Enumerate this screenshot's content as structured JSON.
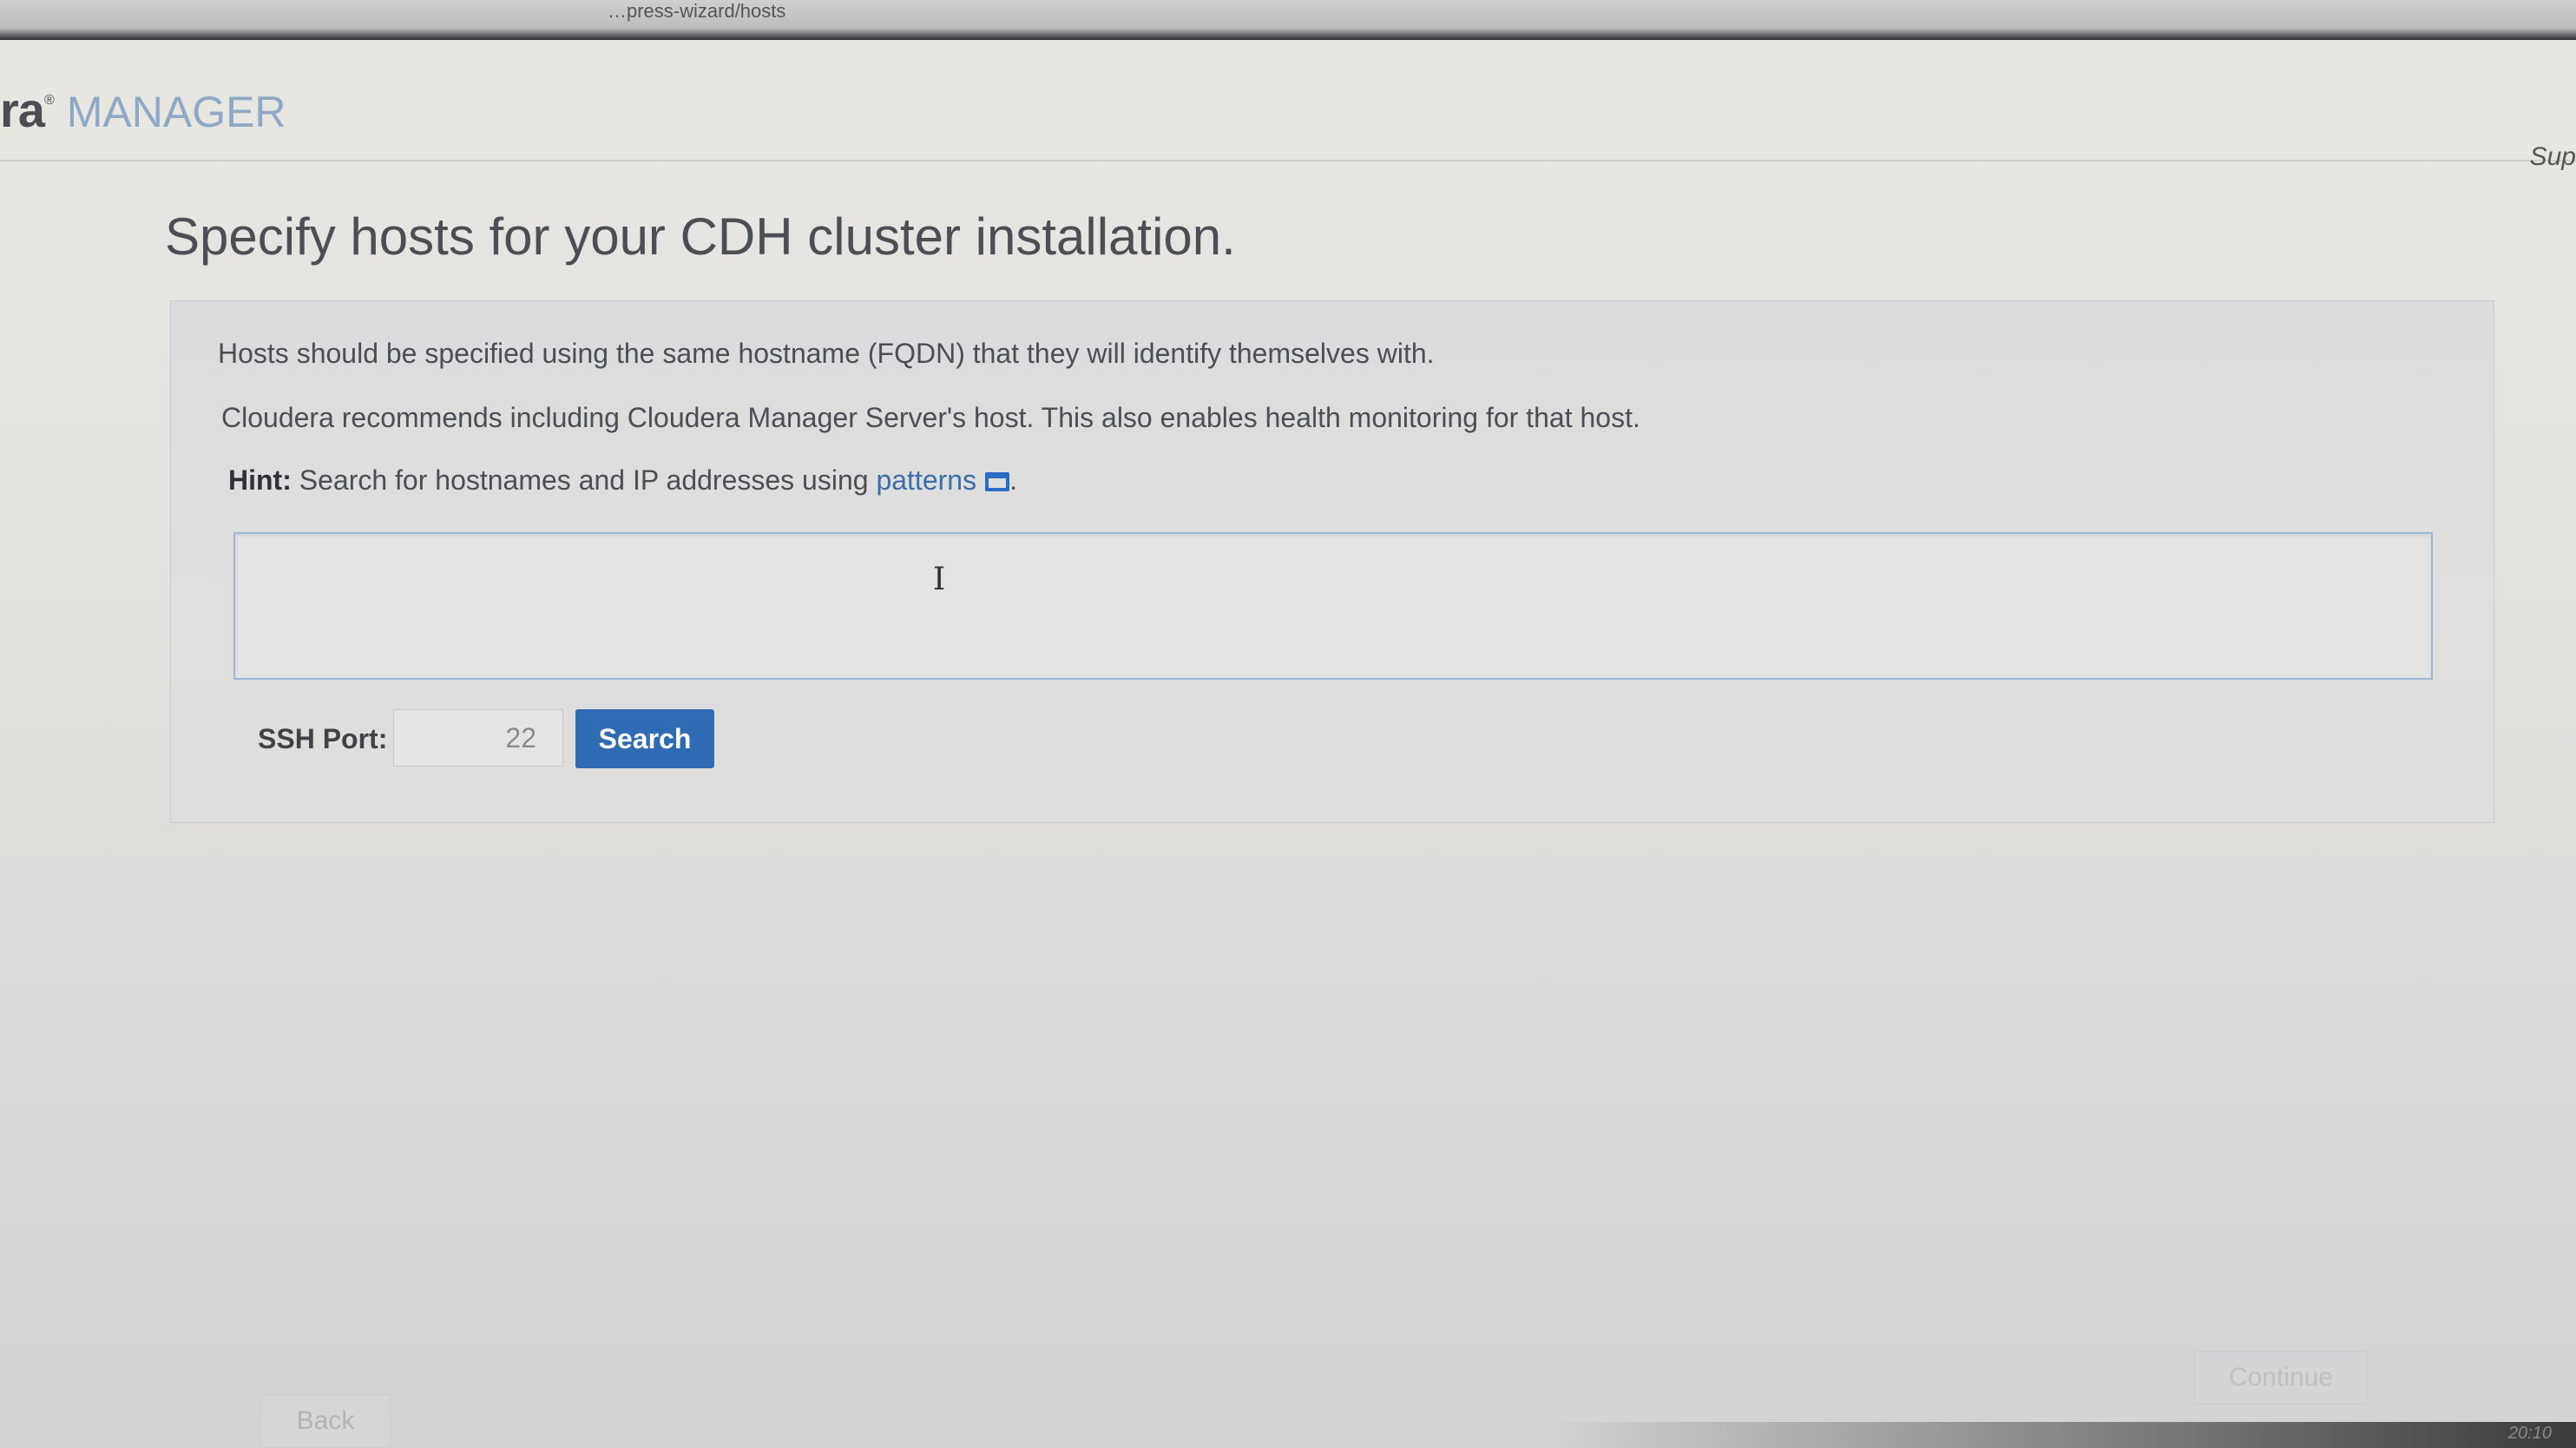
{
  "browser": {
    "url_fragment": "…press-wizard/hosts"
  },
  "header": {
    "brand_prefix": "ra",
    "brand_reg": "®",
    "brand_name": "MANAGER",
    "support_label": "Sup"
  },
  "page": {
    "title": "Specify hosts for your CDH cluster installation."
  },
  "panel": {
    "info_1": "Hosts should be specified using the same hostname (FQDN) that they will identify themselves with.",
    "info_2": "Cloudera recommends including Cloudera Manager Server's host. This also enables health monitoring for that host.",
    "hint_label": "Hint:",
    "hint_text": " Search for hostnames and IP addresses using ",
    "hint_link": "patterns",
    "hint_end": ".",
    "hosts_value": "",
    "cursor_glyph": "I"
  },
  "ssh": {
    "label": "SSH Port:",
    "port_value": "22",
    "search_label": "Search"
  },
  "footer": {
    "back_label": "Back",
    "continue_label": "Continue",
    "clock": "20:10"
  },
  "icons": {
    "link_icon": "external-window-icon",
    "cursor_icon": "text-cursor-icon"
  },
  "colors": {
    "accent": "#2f6bb3",
    "link": "#3a6ea8",
    "brand": "#8ea9c6"
  }
}
